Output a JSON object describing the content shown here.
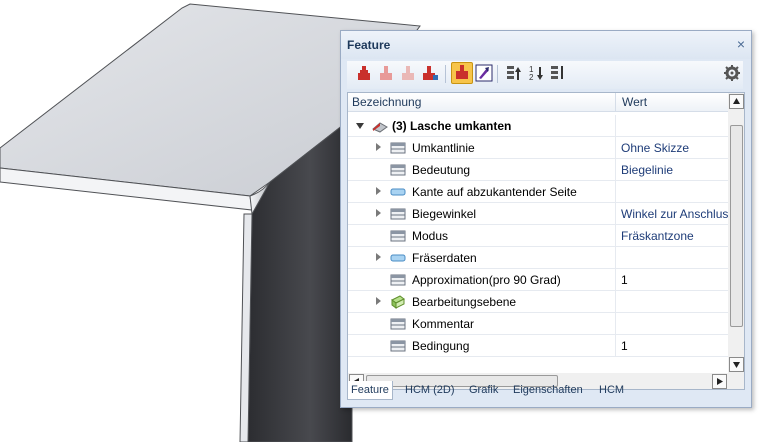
{
  "panel": {
    "title": "Feature",
    "close_glyph": "×",
    "toolbar": [
      {
        "icon": "feature-new-icon"
      },
      {
        "icon": "feature-insert-icon"
      },
      {
        "icon": "feature-disabled-icon"
      },
      {
        "icon": "feature-recalc-icon"
      },
      {
        "icon": "feature-active-icon",
        "active": true
      },
      {
        "icon": "feature-purple-icon"
      },
      {
        "icon": "sort-up-icon"
      },
      {
        "icon": "sort-number-icon"
      },
      {
        "icon": "sort-list-icon"
      },
      {
        "icon": "gear-icon"
      }
    ],
    "columns": {
      "name": "Bezeichnung",
      "value": "Wert"
    },
    "root": {
      "label": "(3) Lasche umkanten"
    },
    "rows": [
      {
        "label": "Umkantlinie",
        "value": "Ohne Skizze",
        "expandable": true,
        "icon": "table-icon"
      },
      {
        "label": "Bedeutung",
        "value": "Biegelinie",
        "expandable": false,
        "icon": "table-icon"
      },
      {
        "label": "Kante auf abzukantender Seite",
        "value": "",
        "expandable": true,
        "icon": "edge-icon"
      },
      {
        "label": "Biegewinkel",
        "value": "Winkel zur Anschlussfläche",
        "expandable": true,
        "icon": "table-icon"
      },
      {
        "label": "Modus",
        "value": "Fräskantzone",
        "expandable": false,
        "icon": "table-icon"
      },
      {
        "label": "Fräserdaten",
        "value": "",
        "expandable": true,
        "icon": "edge-icon"
      },
      {
        "label": "Approximation(pro 90 Grad)",
        "value": "1",
        "expandable": false,
        "icon": "table-icon"
      },
      {
        "label": "Bearbeitungsebene",
        "value": "",
        "expandable": true,
        "icon": "plane-icon"
      },
      {
        "label": "Kommentar",
        "value": "",
        "expandable": false,
        "icon": "table-icon"
      },
      {
        "label": "Bedingung",
        "value": "1",
        "expandable": false,
        "icon": "table-icon"
      }
    ],
    "tabs": [
      "Feature",
      "HCM (2D)",
      "Grafik",
      "Eigenschaften",
      "HCM"
    ],
    "active_tab": "Feature"
  },
  "colors": {
    "accent": "#1e395b",
    "value_text": "#1e3c78",
    "active_tool": "#f7c44a"
  }
}
